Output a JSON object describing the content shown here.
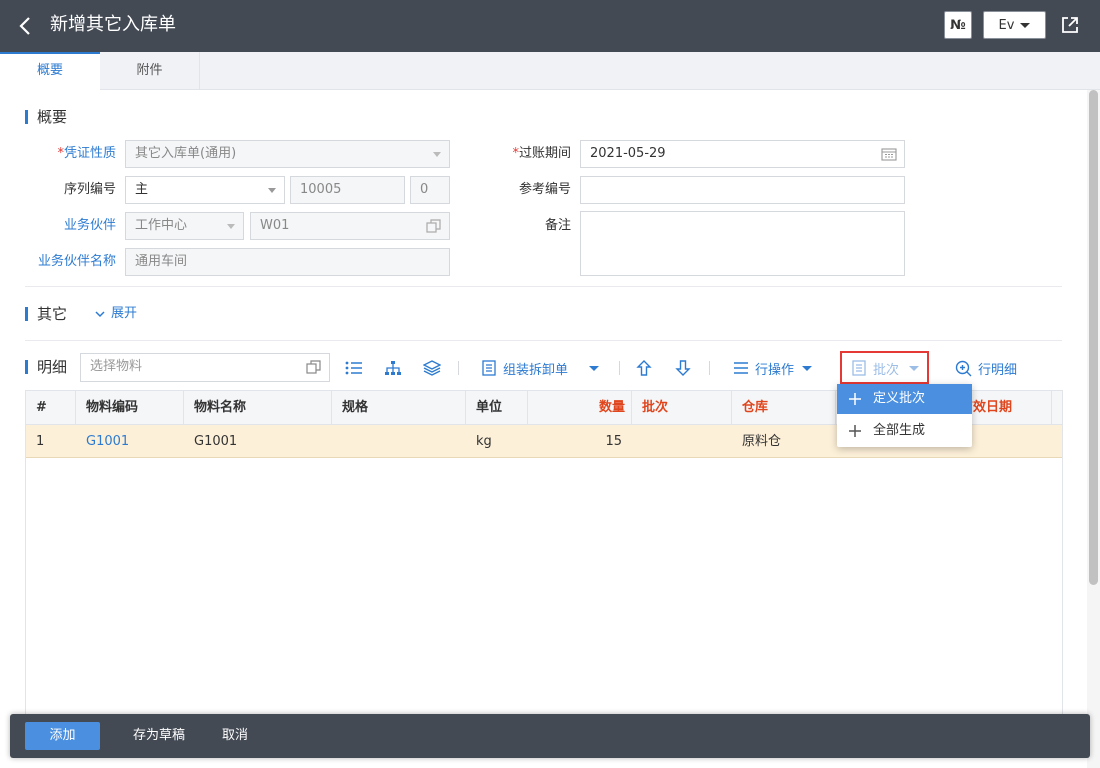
{
  "header": {
    "title": "新增其它入库单",
    "no_label": "№",
    "lang_label": "Ev"
  },
  "tabs": [
    {
      "label": "概要"
    },
    {
      "label": "附件"
    }
  ],
  "overview": {
    "section_title": "概要",
    "voucher_type_label": "凭证性质",
    "voucher_type_value": "其它入库单(通用)",
    "serial_label": "序列编号",
    "serial_value": "主",
    "serial_number": "10005",
    "serial_suffix": "0",
    "partner_label": "业务伙伴",
    "partner_type": "工作中心",
    "partner_code": "W01",
    "partner_name_label": "业务伙伴名称",
    "partner_name_value": "通用车间",
    "posting_label": "过账期间",
    "posting_value": "2021-05-29",
    "ref_label": "参考编号",
    "ref_value": "",
    "remark_label": "备注",
    "remark_value": ""
  },
  "other": {
    "section_title": "其它",
    "expand_label": "展开"
  },
  "detail": {
    "section_title": "明细",
    "search_placeholder": "选择物料",
    "assemble_label": "组装拆卸单",
    "row_ops_label": "行操作",
    "batch_label": "批次",
    "row_detail_label": "行明细"
  },
  "table": {
    "columns": [
      "#",
      "物料编码",
      "物料名称",
      "规格",
      "单位",
      "数量",
      "批次",
      "仓库",
      "有效日期"
    ],
    "rows": [
      {
        "no": "1",
        "code": "G1001",
        "name": "G1001",
        "spec": "",
        "unit": "kg",
        "qty": "15",
        "batch": "",
        "warehouse": "原料仓",
        "expiry": ""
      }
    ]
  },
  "batch_menu": {
    "items": [
      "定义批次",
      "全部生成"
    ]
  },
  "footer": {
    "add_label": "添加",
    "draft_label": "存为草稿",
    "cancel_label": "取消"
  },
  "colors": {
    "header_bg": "#434a54",
    "accent": "#2d7bd1",
    "required": "#e53935",
    "row_highlight": "#fdf0d8"
  }
}
